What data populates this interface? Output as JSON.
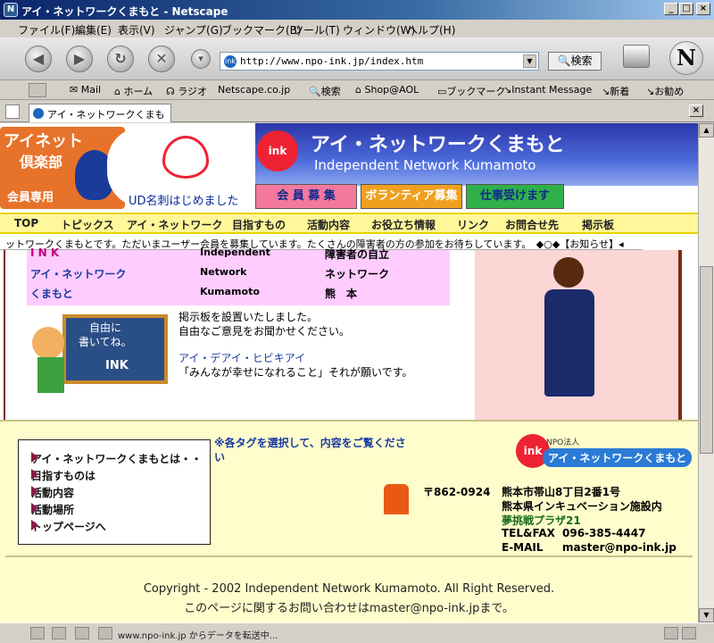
{
  "window": {
    "title": "アイ・ネットワークくまもと - Netscape"
  },
  "menu": [
    "ファイル(F)",
    "編集(E)",
    "表示(V)",
    "ジャンプ(G)",
    "ブックマーク(B)",
    "ツール(T)",
    "ウィンドウ(W)",
    "ヘルプ(H)"
  ],
  "navbar": {
    "url": "http://www.npo-ink.jp/index.htm",
    "search_label": "検索"
  },
  "personal_toolbar": [
    "Mail",
    "ホーム",
    "ラジオ",
    "Netscape.co.jp",
    "検索",
    "Shop@AOL",
    "ブックマーク",
    "Instant Message",
    "新着",
    "お勧め"
  ],
  "tab": {
    "label": "アイ・ネットワークくまもと"
  },
  "page": {
    "club_title": "アイネット",
    "club_sub": "倶楽部",
    "club_member": "会員専用",
    "ud_text": "UD名刺はじめました",
    "site_title": "アイ・ネットワークくまもと",
    "site_title_en": "Independent Network Kumamoto",
    "btn_member": "会 員 募 集",
    "btn_volunteer": "ボランティア募集",
    "btn_work": "仕事受けます",
    "nav": [
      "TOP",
      "トピックス",
      "アイ・ネットワーク",
      "目指すもの",
      "活動内容",
      "お役立ち情報",
      "リンク",
      "お問合せ先",
      "掲示板"
    ],
    "ticker": "ットワークくまもとです。ただいまユーザー会員を募集しています。たくさんの障害者の方の参加をお待ちしています。　◆○◆【お知らせ】◂",
    "table_rows": [
      [
        "I N K",
        "Independent",
        "障害者の自立"
      ],
      [
        "アイ・ネットワーク",
        "Network",
        "ネットワーク"
      ],
      [
        "くまもと",
        "Kumamoto",
        "熊　本"
      ]
    ],
    "board_line1": "自由に",
    "board_line2": "書いてね。",
    "board_ink": "INK",
    "bbs_text1": "掲示板を設置いたしました。",
    "bbs_text2": "自由なご意見をお聞かせください。",
    "motto_title": "アイ・デアイ・ヒビキアイ",
    "motto_text": "「みんなが幸せになれること」それが願いです。",
    "footer_nav": [
      "アイ・ネットワークくまもとは・・",
      "目指すものは",
      "活動内容",
      "活動場所",
      "トップページへ"
    ],
    "tag_note": "※各タグを選択して、内容をご覧ください",
    "npo_label": "NPO法人",
    "npo_name": "アイ・ネットワークくまもと",
    "postal": "〒862-0924",
    "address1": "熊本市帯山8丁目2番1号",
    "address2": "熊本県インキュベーション施設内",
    "address3": "夢挑戦プラザ21",
    "tel_label": "TEL&FAX",
    "tel": "096-385-4447",
    "mail_label": "E-MAIL",
    "mail": "master@npo-ink.jp",
    "copyright": "Copyright  -  2002 Independent Network Kumamoto. All Right Reserved.",
    "contact": "このページに関するお問い合わせはmaster@npo-ink.jpまで。"
  },
  "status": {
    "text": "www.npo-ink.jp からデータを転送中..."
  },
  "colors": {
    "accent_orange": "#e7722a",
    "title_blue": "#0a246a",
    "nav_yellow": "#fff79a",
    "footer_bg": "#fffdcc"
  }
}
